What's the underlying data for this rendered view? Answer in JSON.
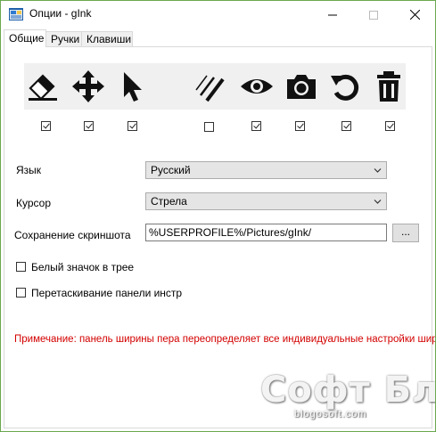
{
  "window": {
    "title": "Опции - gInk"
  },
  "tabs": [
    {
      "label": "Общие"
    },
    {
      "label": "Ручки"
    },
    {
      "label": "Клавиши"
    }
  ],
  "tools": [
    {
      "icon": "eraser-icon",
      "checked": true
    },
    {
      "icon": "move-arrows-icon",
      "checked": true
    },
    {
      "icon": "pointer-cursor-icon",
      "checked": true
    },
    {
      "icon": "pen-width-icon",
      "checked": false
    },
    {
      "icon": "eye-icon",
      "checked": true
    },
    {
      "icon": "camera-icon",
      "checked": true
    },
    {
      "icon": "undo-icon",
      "checked": true
    },
    {
      "icon": "trash-icon",
      "checked": true
    }
  ],
  "form": {
    "language_label": "Язык",
    "language_value": "Русский",
    "cursor_label": "Курсор",
    "cursor_value": "Стрела",
    "screenshot_label": "Сохранение скриншота",
    "screenshot_path": "%USERPROFILE%/Pictures/gInk/",
    "browse_label": "...",
    "white_tray_label": "Белый значок в трее",
    "white_tray_checked": false,
    "drag_toolbar_label": "Перетаскивание панели инстр",
    "drag_toolbar_checked": false
  },
  "note": "Примечание: панель ширины пера переопределяет все индивидуальные настройки ширины",
  "watermark": {
    "title": "Софт Блог",
    "subtitle": "blogosoft.com"
  },
  "colors": {
    "note": "#d40000",
    "border": "#6aa84f"
  }
}
